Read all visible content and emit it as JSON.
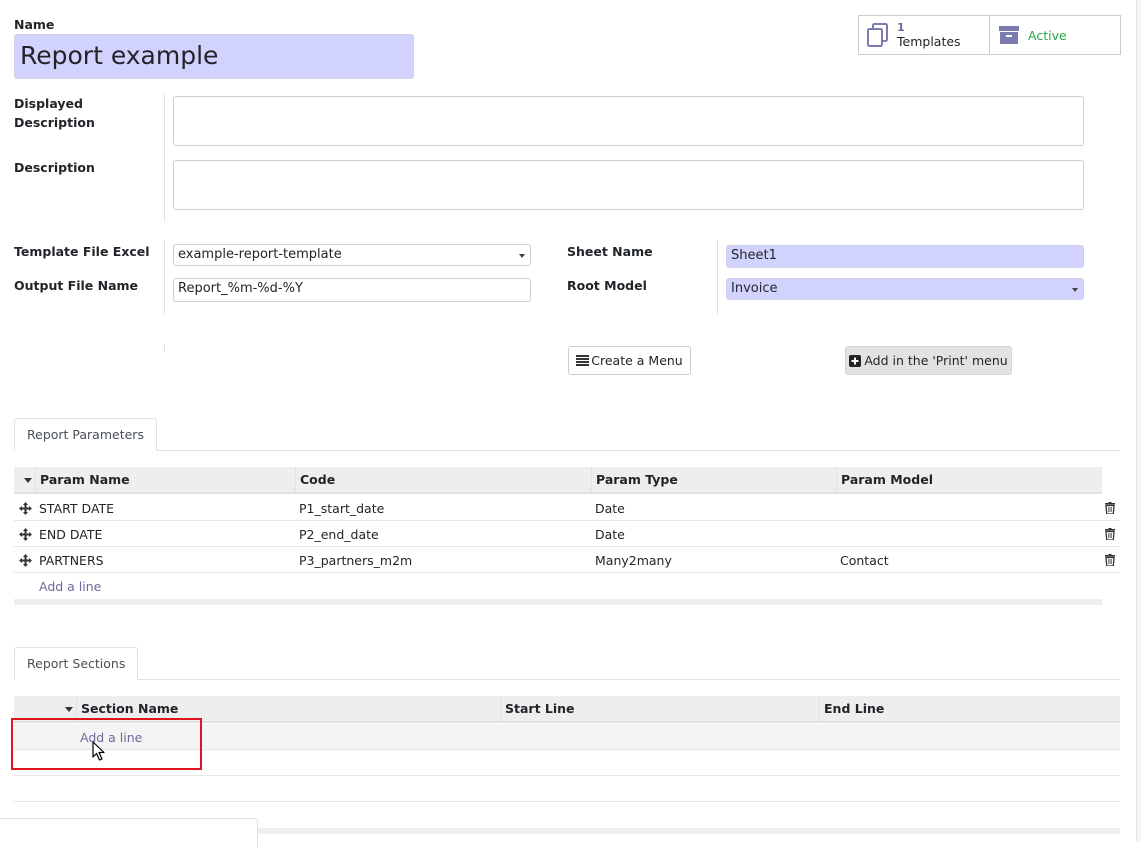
{
  "form": {
    "name_label": "Name",
    "name_value": "Report example",
    "displayed_description_label_1": "Displayed",
    "displayed_description_label_2": "Description",
    "displayed_description_value": "",
    "description_label": "Description",
    "description_value": "",
    "template_file_label": "Template File Excel",
    "template_file_value": "example-report-template",
    "output_file_label": "Output File Name",
    "output_file_value": "Report_%m-%d-%Y",
    "sheet_name_label": "Sheet Name",
    "sheet_name_value": "Sheet1",
    "root_model_label": "Root Model",
    "root_model_value": "Invoice"
  },
  "smart_buttons": {
    "templates_count": "1",
    "templates_label": "Templates",
    "active_label": "Active",
    "active_color": "#28a745",
    "icon_color": "#7c7bad"
  },
  "actions": {
    "create_menu": "Create a Menu",
    "add_print": "Add in the 'Print' menu"
  },
  "params_tab": {
    "tab_label": "Report Parameters",
    "columns": [
      "Param Name",
      "Code",
      "Param Type",
      "Param Model"
    ],
    "rows": [
      {
        "name": "START DATE",
        "code": "P1_start_date",
        "type": "Date",
        "model": ""
      },
      {
        "name": "END DATE",
        "code": "P2_end_date",
        "type": "Date",
        "model": ""
      },
      {
        "name": "PARTNERS",
        "code": "P3_partners_m2m",
        "type": "Many2many",
        "model": "Contact"
      }
    ],
    "add_line": "Add a line"
  },
  "sections_tab": {
    "tab_label": "Report Sections",
    "columns": [
      "Section Name",
      "Start Line",
      "End Line"
    ],
    "add_line": "Add a line"
  }
}
